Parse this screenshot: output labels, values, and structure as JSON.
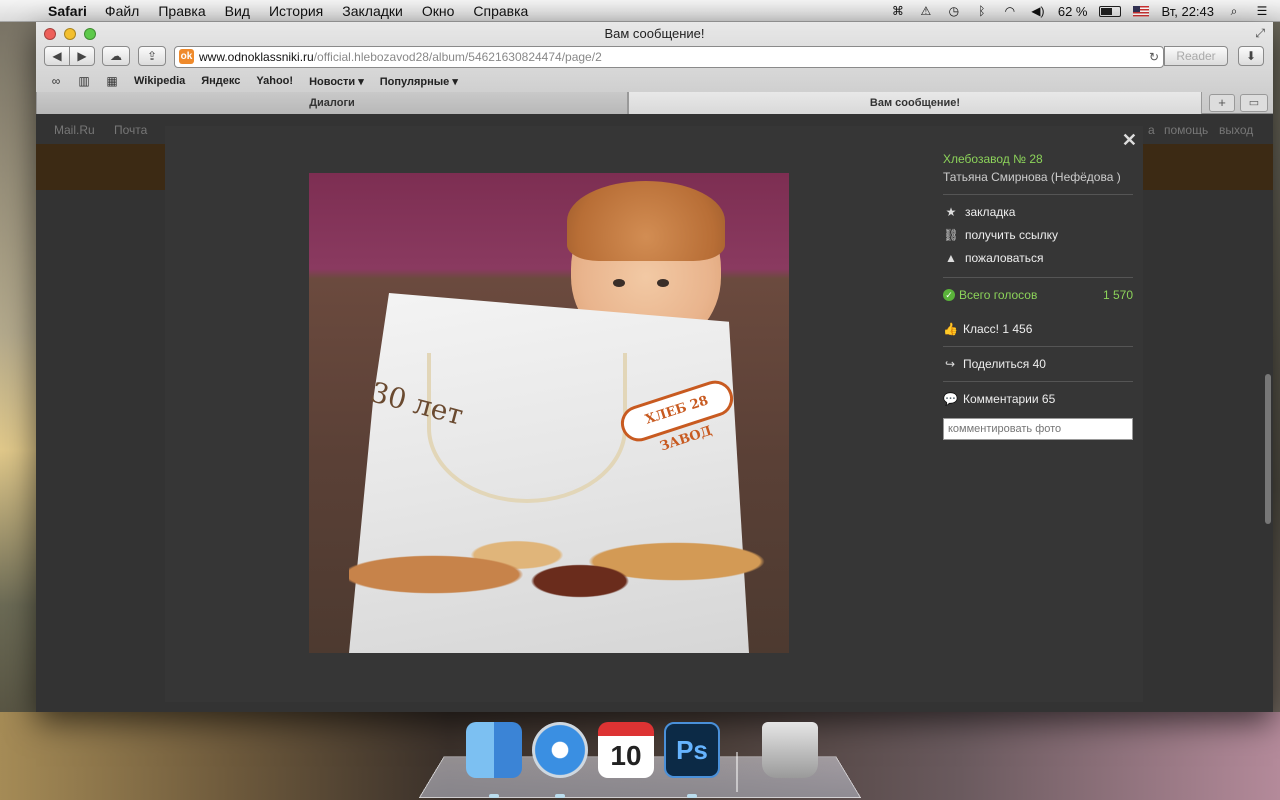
{
  "menubar": {
    "app_name": "Safari",
    "items": [
      "Файл",
      "Правка",
      "Вид",
      "История",
      "Закладки",
      "Окно",
      "Справка"
    ],
    "battery_percent": "62 %",
    "battery_level": 0.62,
    "clock": "Вт, 22:43"
  },
  "window": {
    "title": "Вам сообщение!",
    "address": {
      "host": "www.odnoklassniki.ru",
      "path": "/official.hlebozavod28/album/54621630824474/page/2"
    },
    "reader_label": "Reader",
    "bookmarks": [
      "Wikipedia",
      "Яндекс",
      "Yahoo!",
      "Новости ▾",
      "Популярные ▾"
    ],
    "tabs": [
      "Диалоги",
      "Вам сообщение!"
    ]
  },
  "page": {
    "topbar": [
      "Mail.Ru",
      "Почта",
      "а",
      "помощь",
      "выход"
    ]
  },
  "photo_viewer": {
    "group_name": "Хлебозавод № 28",
    "author": "Татьяна Смирнова (Нефёдова )",
    "actions": {
      "bookmark": "закладка",
      "get_link": "получить ссылку",
      "report": "пожаловаться"
    },
    "votes_label": "Всего голосов",
    "votes_count": "1 570",
    "klass": "Класс! 1 456",
    "share": "Поделиться 40",
    "comments": "Комментарии 65",
    "comment_placeholder": "комментировать фото",
    "photo_logo": "ХЛЕБ 28 ЗАВОД",
    "photo_text": "30 лет"
  },
  "dock": {
    "calendar_month": "ДЕК",
    "calendar_day": "10",
    "ps_label": "Ps"
  }
}
